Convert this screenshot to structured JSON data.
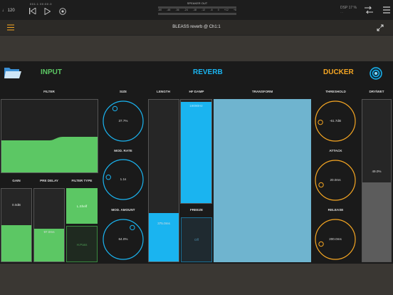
{
  "topbar": {
    "tempo": "♩ 120",
    "time": "001:1  00:00.0",
    "meter_title": "SPEAKER OUT",
    "meter_scale": [
      "-60",
      "-48",
      "-36",
      "-24",
      "-18",
      "-12",
      "-6",
      "0",
      "+12",
      "+6"
    ],
    "cpu": "DSP 17 %",
    "cpu_sub": "···"
  },
  "plugin": {
    "title": "BLEASS reverb @ Ch1:1"
  },
  "sections": {
    "input": "INPUT",
    "reverb": "REVERB",
    "ducker": "DUCKER"
  },
  "colors": {
    "green": "#5cc764",
    "blue": "#1ab4f0",
    "orange": "#f5a623",
    "transform": "#6fb4cf"
  },
  "labels": {
    "filter": "FILTER",
    "size": "SIZE",
    "length": "LENGTH",
    "hf_damp": "HF DAMP",
    "transform": "TRANSFORM",
    "threshold": "THRESHOLD",
    "dry_wet": "DRY/WET",
    "mod_rate": "MOD. RATE",
    "attack": "ATTACK",
    "gain": "GAIN",
    "pre_delay": "PRE DELAY",
    "filter_type": "FILTER TYPE",
    "freeze": "FREEZE",
    "mod_amount": "MOD. AMOUNT",
    "release": "RELEASE"
  },
  "values": {
    "size": "37.7%",
    "mod_rate": "1.1s",
    "mod_amount": "64.0%",
    "length": "375.0ms",
    "hf_damp": "19090Hz",
    "freeze": "Off",
    "threshold": "-61.7dB",
    "attack": "20.0ms",
    "release": "200.0ms",
    "dry_wet": "49.0%",
    "gain": "0.0dB",
    "pre_delay": "97.0ms",
    "filter_type_a": "L.Shelf",
    "filter_type_b": "H.Pass"
  },
  "levels": {
    "size": 0.377,
    "mod_rate": 0.2,
    "mod_amount": 0.64,
    "threshold": 0.15,
    "attack": 0.1,
    "release": 0.1,
    "length": 0.3,
    "hf_damp": 0.98,
    "dry_wet": 0.49,
    "gain": 0.5,
    "pre_delay": 0.45
  }
}
